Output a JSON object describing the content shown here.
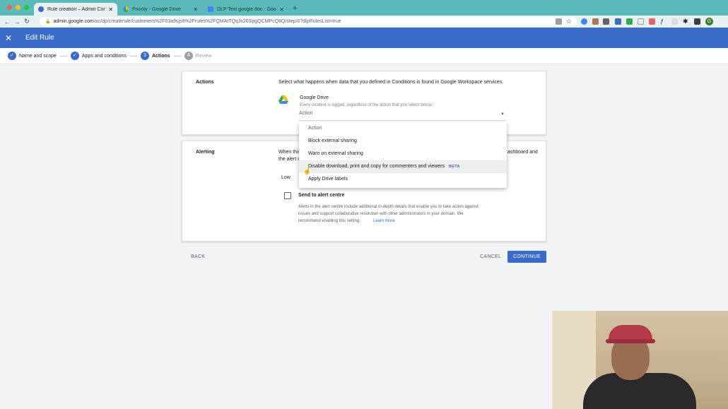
{
  "browser": {
    "tabs": [
      {
        "title": "Rule creation – Admin Console",
        "active": true
      },
      {
        "title": "Priority - Google Drive",
        "active": false
      },
      {
        "title": "DLP Test google doc - Google",
        "active": false
      }
    ],
    "new_tab": "+",
    "url_host": "admin.google.com",
    "url_path": "/ac/dp/createrule/customers%2F03a9sjs9%2Frules%2FQMAtTQqJx26SpgQCMPcQ8Q/step/0?dlpRulesList=true",
    "profile_initial": "G"
  },
  "header": {
    "title": "Edit Rule",
    "close_icon": "close-icon"
  },
  "stepper": {
    "steps": [
      {
        "label": "Name and scope",
        "state": "done",
        "marker": "✓"
      },
      {
        "label": "Apps and conditions",
        "state": "done",
        "marker": "✓"
      },
      {
        "label": "Actions",
        "state": "current",
        "marker": "3"
      },
      {
        "label": "Review",
        "state": "pending",
        "marker": "4"
      }
    ]
  },
  "actions_card": {
    "title": "Actions",
    "description": "Select what happens when data that you defined in Conditions is found in Google Workspace services.",
    "service_name": "Google Drive",
    "service_note": "Every incident is logged, regardless of the action that you select below.",
    "select_value": "Action"
  },
  "dropdown": {
    "items": [
      {
        "label": "Action",
        "muted": true
      },
      {
        "label": "Block external sharing"
      },
      {
        "label": "Warn on external sharing"
      },
      {
        "label": "Disable download, print and copy for commenters and viewers",
        "badge": "BETA",
        "hover": true
      },
      {
        "label": "Apply Drive labels"
      }
    ]
  },
  "alerting_card": {
    "title": "Alerting",
    "desc_left": "When this",
    "desc_left_2": "the alert c",
    "desc_right": "ashboard and",
    "severity_value": "Low",
    "checkbox_label": "Send to alert centre",
    "checkbox_checked": false,
    "help_line_1": "Alerts in the alert centre include additional in-depth details that enable you to take action against",
    "help_line_2": "issues and support collaborative resolution with other administrators in your domain. We",
    "help_line_3": "recommend enabling this setting.",
    "learn_more": "Learn more"
  },
  "footer": {
    "back": "BACK",
    "cancel": "CANCEL",
    "continue": "CONTINUE"
  },
  "colors": {
    "primary": "#3b6bc9",
    "tabstrip": "#5bb9b9",
    "link": "#1a73e8"
  }
}
